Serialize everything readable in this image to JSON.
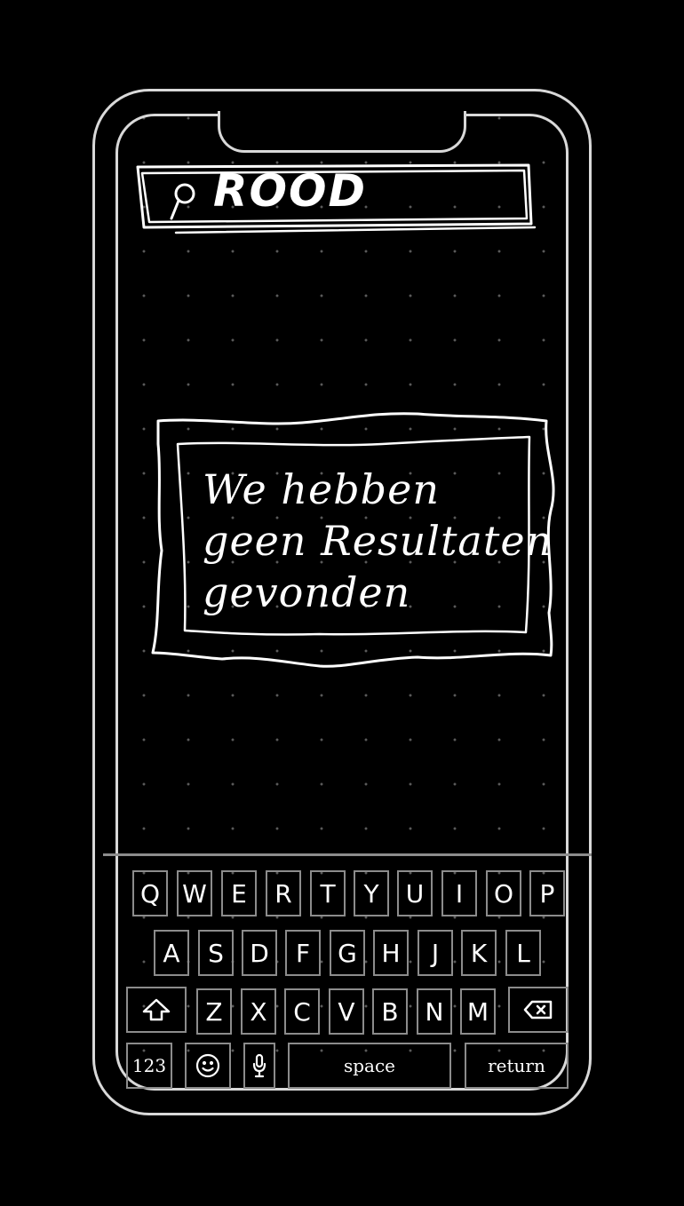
{
  "search": {
    "query": "ROOD",
    "icon": "search-icon"
  },
  "empty_state": {
    "lines": [
      "We hebben",
      "geen Resultaten",
      "gevonden"
    ]
  },
  "keyboard": {
    "row1": [
      "Q",
      "W",
      "E",
      "R",
      "T",
      "Y",
      "U",
      "I",
      "O",
      "P"
    ],
    "row2": [
      "A",
      "S",
      "D",
      "F",
      "G",
      "H",
      "J",
      "K",
      "L"
    ],
    "row3": [
      "Z",
      "X",
      "C",
      "V",
      "B",
      "N",
      "M"
    ],
    "numbers_label": "123",
    "space_label": "space",
    "return_label": "return",
    "icons": {
      "shift": "shift-arrow-icon",
      "backspace": "backspace-icon",
      "emoji": "emoji-icon",
      "mic": "microphone-icon"
    }
  }
}
